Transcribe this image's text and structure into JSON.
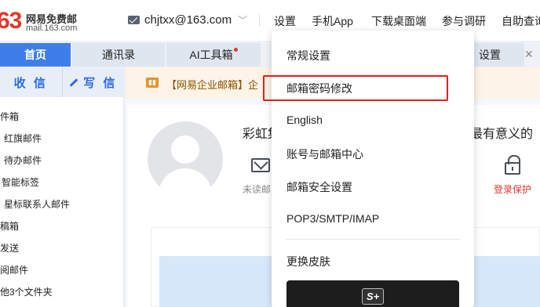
{
  "brand": {
    "logo_number": "63",
    "name": "网易免费邮",
    "domain": "mail.163.com"
  },
  "header": {
    "account": "chjtxx@163.com",
    "nav": [
      "设置",
      "手机App",
      "下载桌面端",
      "参与调研",
      "自助查询"
    ]
  },
  "tabs": [
    "首页",
    "通讯录",
    "AI工具箱",
    "设置"
  ],
  "sidebar": {
    "receive": "收 信",
    "compose": "写 信",
    "items": [
      "件箱",
      "红旗邮件",
      "待办邮件",
      "智能标签",
      "星标联系人邮件",
      "稿箱",
      "发送",
      "阅邮件",
      "他3个文件夹"
    ]
  },
  "main": {
    "notice": "【网易企业邮箱】企",
    "greeting_start": "彩虹集",
    "greeting_end": "最有意义的",
    "unread": "未读邮",
    "login_protect": "登录保护"
  },
  "dropdown": {
    "items": [
      "常规设置",
      "邮箱密码修改",
      "English",
      "账号与邮箱中心",
      "邮箱安全设置",
      "POP3/SMTP/IMAP",
      "更换皮肤"
    ],
    "skin_badge": "S+"
  },
  "colors": {
    "accent": "#3f7ee8",
    "brand_red": "#e3352b",
    "highlight": "#e02020"
  },
  "icons": [
    "mail-icon",
    "chevron-down-icon",
    "close-icon",
    "pen-icon",
    "notice-icon",
    "avatar-icon",
    "envelope-icon",
    "lock-icon"
  ]
}
